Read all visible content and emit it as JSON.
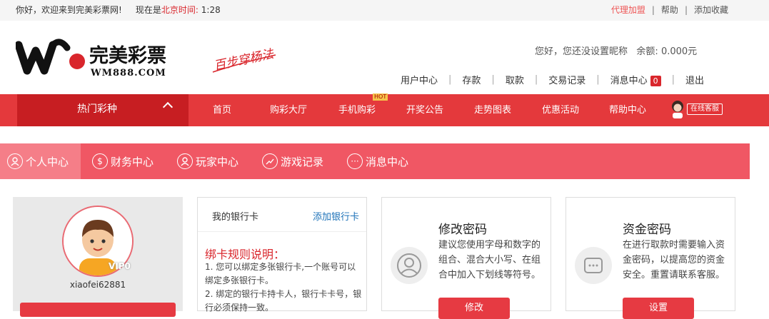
{
  "topbar": {
    "welcome": "你好，欢迎来到完美彩票网!",
    "time_prefix": "现在是",
    "time_label": "北京时间:",
    "time": "1:28",
    "links": [
      "代理加盟",
      "帮助",
      "添加收藏"
    ]
  },
  "brand": {
    "name": "完美彩票",
    "domain": "WM888.COM",
    "slogan": "百步穿杨法"
  },
  "account": {
    "greeting": "您好，您还没设置昵称",
    "balance_label": "余额:",
    "balance": "0.000元"
  },
  "header_nav": [
    {
      "label": "用户中心"
    },
    {
      "label": "存款"
    },
    {
      "label": "取款"
    },
    {
      "label": "交易记录"
    },
    {
      "label": "消息中心",
      "badge": "0"
    },
    {
      "label": "退出"
    }
  ],
  "main_nav": {
    "hot_lottery": "热门彩种",
    "hot_label": "HOT",
    "items": [
      "首页",
      "购彩大厅",
      "手机购彩",
      "开奖公告",
      "走势图表",
      "优惠活动",
      "帮助中心"
    ],
    "service": "在线客服"
  },
  "sub_nav": [
    {
      "label": "个人中心",
      "icon": "user-icon",
      "active": true
    },
    {
      "label": "财务中心",
      "icon": "dollar-icon",
      "active": false
    },
    {
      "label": "玩家中心",
      "icon": "player-icon",
      "active": false
    },
    {
      "label": "游戏记录",
      "icon": "trend-icon",
      "active": false
    },
    {
      "label": "消息中心",
      "icon": "more-icon",
      "active": false
    }
  ],
  "profile": {
    "vip": "VIP0",
    "username": "xiaofei62881"
  },
  "bank": {
    "title": "我的银行卡",
    "add": "添加银行卡",
    "rules_title": "绑卡规则说明：",
    "rules": [
      "1. 您可以绑定多张银行卡,一个账号可以绑定多张银行卡。",
      "2. 绑定的银行卡持卡人，银行卡卡号，银行必须保持一致。"
    ]
  },
  "password": {
    "title": "修改密码",
    "desc": "建议您使用字母和数字的组合、混合大小写、在组合中加入下划线等符号。",
    "button": "修改"
  },
  "fund_password": {
    "title": "资金密码",
    "desc": "在进行取款时需要输入资金密码，以提高您的资金安全。重置请联系客服。",
    "button": "设置"
  },
  "colors": {
    "accent": "#e4393c",
    "subnav": "#f05764",
    "link": "#1d72b8"
  }
}
